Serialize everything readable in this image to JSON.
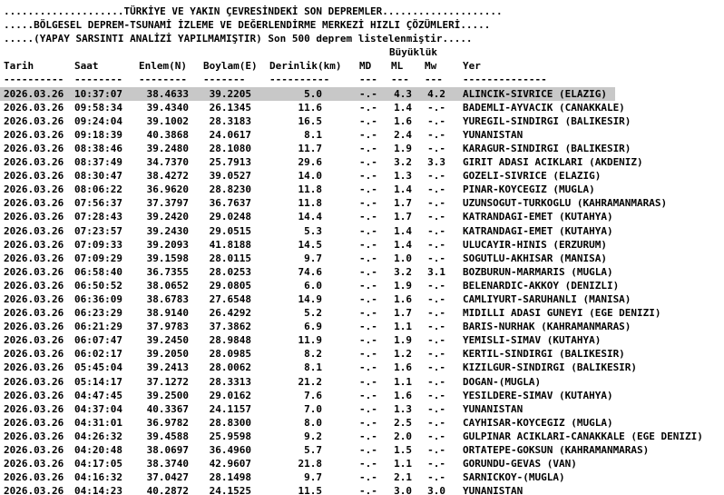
{
  "banner": [
    "....................TÜRKİYE VE YAKIN ÇEVRESİNDEKİ SON DEPREMLER....................",
    ".....BÖLGESEL DEPREM-TSUNAMİ İZLEME VE DEĞERLENDİRME MERKEZİ HIZLI ÇÖZÜMLERİ.....",
    ".....(YAPAY SARSINTI ANALİZİ YAPILMAMIŞTIR) Son 500 deprem listelenmiştir....."
  ],
  "columns": {
    "group_label": "Büyüklük",
    "tarih": "Tarih",
    "saat": "Saat",
    "enlem": "Enlem(N)",
    "boylam": "Boylam(E)",
    "derinlik": "Derinlik(km)",
    "md": "MD",
    "ml": "ML",
    "mw": "Mw",
    "yer": "Yer"
  },
  "separator": {
    "tarih": "----------",
    "saat": "--------",
    "enlem": "--------",
    "boylam": "-------",
    "derinlik": "----------",
    "md": "---",
    "ml": "---",
    "mw": "---",
    "yer": "--------------"
  },
  "rows": [
    [
      "2026.03.26",
      "10:37:07",
      "38.4633",
      "39.2205",
      "5.0",
      "-.-",
      "4.3",
      "4.2",
      "ALINCIK-SIVRICE (ELAZIG)"
    ],
    [
      "2026.03.26",
      "09:58:34",
      "39.4340",
      "26.1345",
      "11.6",
      "-.-",
      "1.4",
      "-.-",
      "BADEMLI-AYVACIK (CANAKKALE)"
    ],
    [
      "2026.03.26",
      "09:24:04",
      "39.1002",
      "28.3183",
      "16.5",
      "-.-",
      "1.6",
      "-.-",
      "YUREGIL-SINDIRGI (BALIKESIR)"
    ],
    [
      "2026.03.26",
      "09:18:39",
      "40.3868",
      "24.0617",
      "8.1",
      "-.-",
      "2.4",
      "-.-",
      "YUNANISTAN"
    ],
    [
      "2026.03.26",
      "08:38:46",
      "39.2480",
      "28.1080",
      "11.7",
      "-.-",
      "1.9",
      "-.-",
      "KARAGUR-SINDIRGI (BALIKESIR)"
    ],
    [
      "2026.03.26",
      "08:37:49",
      "34.7370",
      "25.7913",
      "29.6",
      "-.-",
      "3.2",
      "3.3",
      "GIRIT ADASI ACIKLARI (AKDENIZ)"
    ],
    [
      "2026.03.26",
      "08:30:47",
      "38.4272",
      "39.0527",
      "14.0",
      "-.-",
      "1.3",
      "-.-",
      "GOZELI-SIVRICE (ELAZIG)"
    ],
    [
      "2026.03.26",
      "08:06:22",
      "36.9620",
      "28.8230",
      "11.8",
      "-.-",
      "1.4",
      "-.-",
      "PINAR-KOYCEGIZ (MUGLA)"
    ],
    [
      "2026.03.26",
      "07:56:37",
      "37.3797",
      "36.7637",
      "11.8",
      "-.-",
      "1.7",
      "-.-",
      "UZUNSOGUT-TURKOGLU (KAHRAMANMARAS)"
    ],
    [
      "2026.03.26",
      "07:28:43",
      "39.2420",
      "29.0248",
      "14.4",
      "-.-",
      "1.7",
      "-.-",
      "KATRANDAGI-EMET (KUTAHYA)"
    ],
    [
      "2026.03.26",
      "07:23:57",
      "39.2430",
      "29.0515",
      "5.3",
      "-.-",
      "1.4",
      "-.-",
      "KATRANDAGI-EMET (KUTAHYA)"
    ],
    [
      "2026.03.26",
      "07:09:33",
      "39.2093",
      "41.8188",
      "14.5",
      "-.-",
      "1.4",
      "-.-",
      "ULUCAYIR-HINIS (ERZURUM)"
    ],
    [
      "2026.03.26",
      "07:09:29",
      "39.1598",
      "28.0115",
      "9.7",
      "-.-",
      "1.0",
      "-.-",
      "SOGUTLU-AKHISAR (MANISA)"
    ],
    [
      "2026.03.26",
      "06:58:40",
      "36.7355",
      "28.0253",
      "74.6",
      "-.-",
      "3.2",
      "3.1",
      "BOZBURUN-MARMARIS (MUGLA)"
    ],
    [
      "2026.03.26",
      "06:50:52",
      "38.0652",
      "29.0805",
      "6.0",
      "-.-",
      "1.9",
      "-.-",
      "BELENARDIC-AKKOY (DENIZLI)"
    ],
    [
      "2026.03.26",
      "06:36:09",
      "38.6783",
      "27.6548",
      "14.9",
      "-.-",
      "1.6",
      "-.-",
      "CAMLIYURT-SARUHANLI (MANISA)"
    ],
    [
      "2026.03.26",
      "06:23:29",
      "38.9140",
      "26.4292",
      "5.2",
      "-.-",
      "1.7",
      "-.-",
      "MIDILLI ADASI GUNEYI (EGE DENIZI)"
    ],
    [
      "2026.03.26",
      "06:21:29",
      "37.9783",
      "37.3862",
      "6.9",
      "-.-",
      "1.1",
      "-.-",
      "BARIS-NURHAK (KAHRAMANMARAS)"
    ],
    [
      "2026.03.26",
      "06:07:47",
      "39.2450",
      "28.9848",
      "11.9",
      "-.-",
      "1.9",
      "-.-",
      "YEMISLI-SIMAV (KUTAHYA)"
    ],
    [
      "2026.03.26",
      "06:02:17",
      "39.2050",
      "28.0985",
      "8.2",
      "-.-",
      "1.2",
      "-.-",
      "KERTIL-SINDIRGI (BALIKESIR)"
    ],
    [
      "2026.03.26",
      "05:45:04",
      "39.2413",
      "28.0062",
      "8.1",
      "-.-",
      "1.6",
      "-.-",
      "KIZILGUR-SINDIRGI (BALIKESIR)"
    ],
    [
      "2026.03.26",
      "05:14:17",
      "37.1272",
      "28.3313",
      "21.2",
      "-.-",
      "1.1",
      "-.-",
      "DOGAN-(MUGLA)"
    ],
    [
      "2026.03.26",
      "04:47:45",
      "39.2500",
      "29.0162",
      "7.6",
      "-.-",
      "1.6",
      "-.-",
      "YESILDERE-SIMAV (KUTAHYA)"
    ],
    [
      "2026.03.26",
      "04:37:04",
      "40.3367",
      "24.1157",
      "7.0",
      "-.-",
      "1.3",
      "-.-",
      "YUNANISTAN"
    ],
    [
      "2026.03.26",
      "04:31:01",
      "36.9782",
      "28.8300",
      "8.0",
      "-.-",
      "2.5",
      "-.-",
      "CAYHISAR-KOYCEGIZ (MUGLA)"
    ],
    [
      "2026.03.26",
      "04:26:32",
      "39.4588",
      "25.9598",
      "9.2",
      "-.-",
      "2.0",
      "-.-",
      "GULPINAR ACIKLARI-CANAKKALE (EGE DENIZI)"
    ],
    [
      "2026.03.26",
      "04:20:48",
      "38.0697",
      "36.4960",
      "5.7",
      "-.-",
      "1.5",
      "-.-",
      "ORTATEPE-GOKSUN (KAHRAMANMARAS)"
    ],
    [
      "2026.03.26",
      "04:17:05",
      "38.3740",
      "42.9607",
      "21.8",
      "-.-",
      "1.1",
      "-.-",
      "GORUNDU-GEVAS (VAN)"
    ],
    [
      "2026.03.26",
      "04:16:32",
      "37.0427",
      "28.1498",
      "9.7",
      "-.-",
      "2.1",
      "-.-",
      "SARNICKOY-(MUGLA)"
    ],
    [
      "2026.03.26",
      "04:14:23",
      "40.2872",
      "24.1525",
      "11.5",
      "-.-",
      "3.0",
      "3.0",
      "YUNANISTAN"
    ]
  ],
  "colors": {
    "background": "#ffffff",
    "text": "#000000",
    "highlight_row": "#c8c8c8"
  }
}
